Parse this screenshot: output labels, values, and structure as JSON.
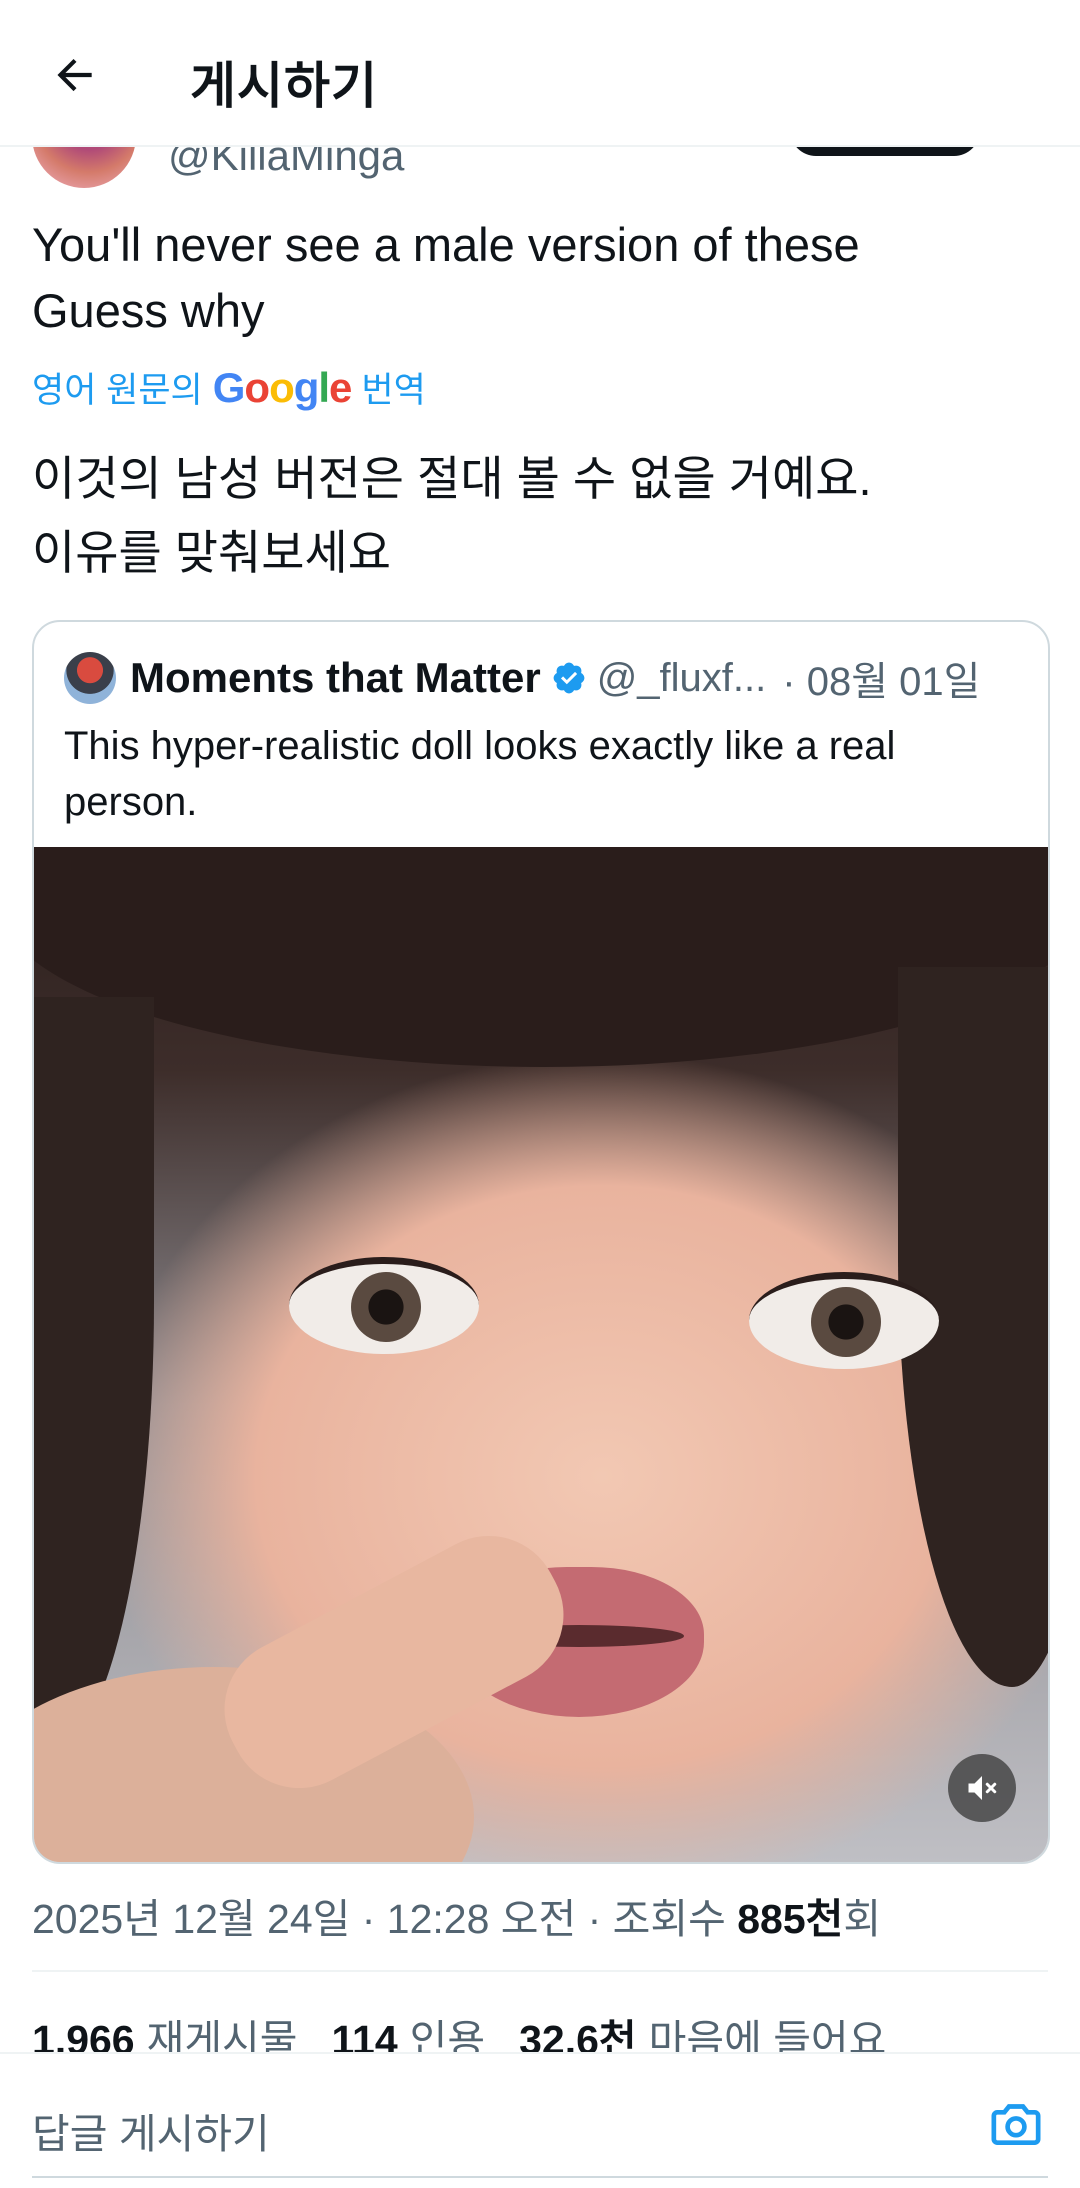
{
  "header": {
    "title": "게시하기"
  },
  "tweet": {
    "handle": "@KillaMinga",
    "text": "You'll never see a male version of these\nGuess why",
    "translate_prefix": "영어 원문의",
    "translate_brand": "Google",
    "translate_suffix": "번역",
    "translated_text": "이것의 남성 버전은 절대 볼 수 없을 거예요.\n이유를 맞춰보세요"
  },
  "quote": {
    "name": "Moments that Matter",
    "handle": "@_fluxf...",
    "date": "· 08월 01일",
    "text": "This hyper-realistic doll looks exactly like a real person."
  },
  "meta": {
    "datetime": "2025년 12월 24일 · 12:28 오전 · 조회수 ",
    "views_value": "885천",
    "views_suffix": "회"
  },
  "stats": {
    "reposts_value": "1,966",
    "reposts_label": "재게시물",
    "quotes_value": "114",
    "quotes_label": "인용",
    "likes_value": "32.6천",
    "likes_label": "마음에 들어요"
  },
  "reply": {
    "placeholder": "답글 게시하기"
  },
  "colors": {
    "accent": "#1d9bf0",
    "text": "#0f1419",
    "muted": "#536471",
    "border": "#cfd9de"
  },
  "icons": [
    "back-arrow-icon",
    "verified-badge-icon",
    "mute-icon",
    "camera-icon"
  ]
}
